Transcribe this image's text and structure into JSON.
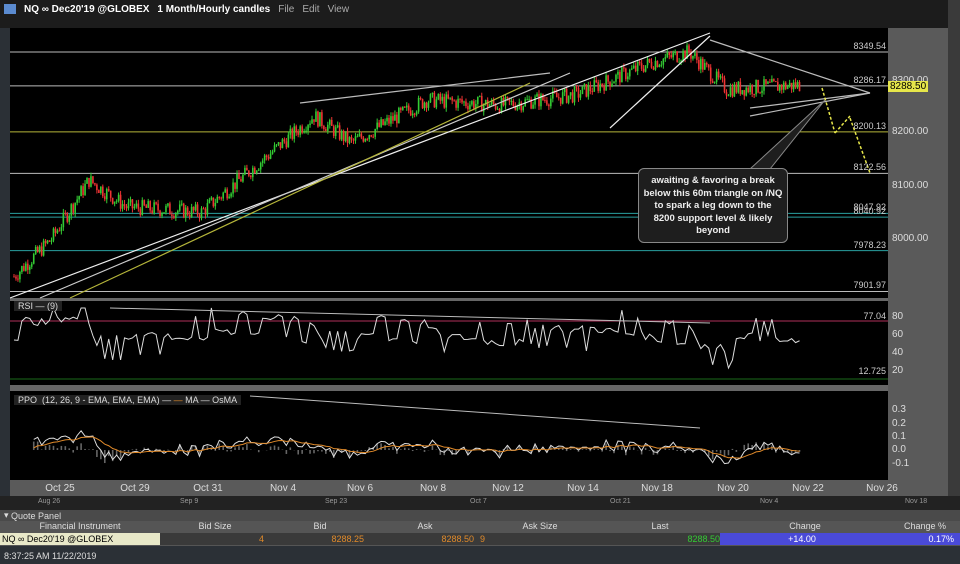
{
  "window": {
    "symbol": "NQ ∞ Dec20'19 @GLOBEX",
    "timeframe": "1 Month/Hourly candles",
    "menus": [
      "File",
      "Edit",
      "View"
    ]
  },
  "price_axis": {
    "ticks": [
      "8300.00",
      "8200.00",
      "8100.00",
      "8000.00"
    ],
    "last_price": "8288.50",
    "last_color": "#e6e64a"
  },
  "levels": [
    {
      "label": "8349.54",
      "value": 8349.54,
      "color": "#bbbbbb"
    },
    {
      "label": "8286.17",
      "value": 8286.17,
      "color": "#bbbbbb"
    },
    {
      "label": "8200.13",
      "value": 8200.13,
      "color": "#b5b53a"
    },
    {
      "label": "8122.56",
      "value": 8122.56,
      "color": "#bbbbbb"
    },
    {
      "label": "8047.92",
      "value": 8047.92,
      "color": "#2aa0a0"
    },
    {
      "label": "8040.92",
      "value": 8040.92,
      "color": "#2aa0a0"
    },
    {
      "label": "7978.23",
      "value": 7978.23,
      "color": "#2aa0a0"
    },
    {
      "label": "7901.97",
      "value": 7901.97,
      "color": "#bbbbbb"
    }
  ],
  "price_path": {
    "dates": [
      "Oct 24",
      "Oct 25",
      "Oct 28",
      "Oct 29",
      "Oct 31",
      "Nov 4",
      "Nov 5",
      "Nov 6",
      "Nov 8",
      "Nov 12",
      "Nov 14",
      "Nov 18",
      "Nov 19",
      "Nov 20",
      "Nov 22"
    ],
    "closes": [
      7930,
      8000,
      8110,
      8060,
      8050,
      8170,
      8230,
      8180,
      8260,
      8250,
      8270,
      8330,
      8350,
      8280,
      8288
    ]
  },
  "annotation": "awaiting & favoring a break below this 60m triangle on /NQ to spark a leg down to the 8200 support level & likely beyond",
  "rsi": {
    "label": "RSI",
    "params": "(9)",
    "ticks": [
      "80",
      "60",
      "40",
      "20"
    ],
    "upper": "77.04",
    "lower": "12.725"
  },
  "ppo": {
    "label": "PPO",
    "params": "(12, 26, 9 - EMA, EMA, EMA)",
    "ma": "MA",
    "osma": "OsMA",
    "ticks": [
      "0.3",
      "0.2",
      "0.1",
      "0.0",
      "-0.1"
    ]
  },
  "date_axis": [
    "Oct 25",
    "Oct 29",
    "Oct 31",
    "Nov 4",
    "Nov 6",
    "Nov 8",
    "Nov 12",
    "Nov 14",
    "Nov 18",
    "Nov 20",
    "Nov 22",
    "Nov 26"
  ],
  "scroller": [
    "Aug 26",
    "Sep 9",
    "Sep 23",
    "Oct 7",
    "Oct 21",
    "Nov 4",
    "Nov 18"
  ],
  "quote_panel": {
    "title": "Quote Panel",
    "columns": [
      "Financial Instrument",
      "Bid Size",
      "Bid",
      "Ask",
      "Ask Size",
      "Last",
      "Change",
      "Change %"
    ],
    "row": {
      "instrument": "NQ ∞ Dec20'19 @GLOBEX",
      "bid_size": "4",
      "bid": "8288.25",
      "ask": "8288.50",
      "ask_size": "9",
      "last": "8288.50",
      "change": "+14.00",
      "change_pct": "0.17%"
    }
  },
  "status": {
    "time": "8:37:25 AM 11/22/2019"
  }
}
